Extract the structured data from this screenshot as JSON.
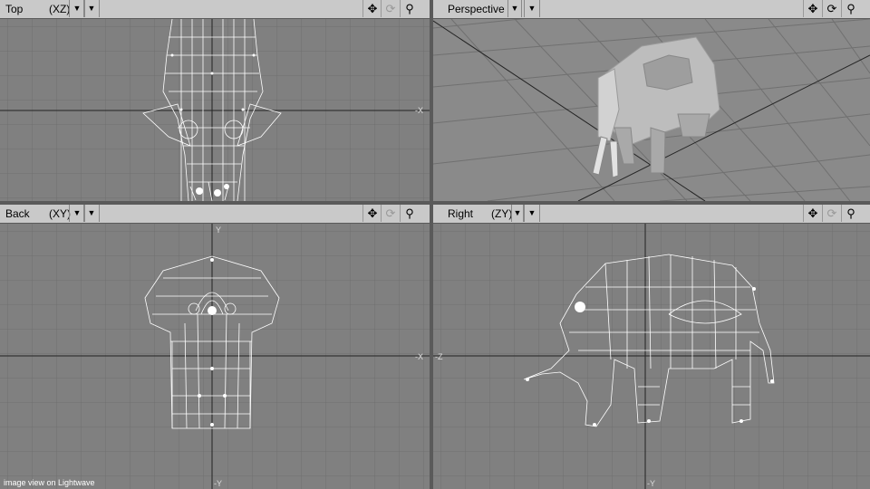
{
  "viewports": [
    {
      "name": "Top",
      "axis": "(XZ)",
      "view_menu_label": "▼"
    },
    {
      "name": "Perspective",
      "axis": "",
      "view_menu_label": "▼"
    },
    {
      "name": "Back",
      "axis": "(XY)",
      "view_menu_label": "▼"
    },
    {
      "name": "Right",
      "axis": "(ZY)",
      "view_menu_label": "▼"
    }
  ],
  "icons": {
    "move": "move-icon",
    "rotate": "rotate-icon",
    "zoom": "magnifier-icon"
  },
  "axis_labels": {
    "top_right": "-X",
    "back_bottom": "-Y",
    "back_top": "Y",
    "back_right": "-X",
    "right_left": "-Z",
    "right_bottom": "-Y"
  },
  "caption": "image view on Lightwave",
  "colors": {
    "viewport_bg": "#808080",
    "header_bg": "#c9c9c9",
    "wire": "#ffffff",
    "grid": "#6f6f6f",
    "axis": "#222222"
  }
}
